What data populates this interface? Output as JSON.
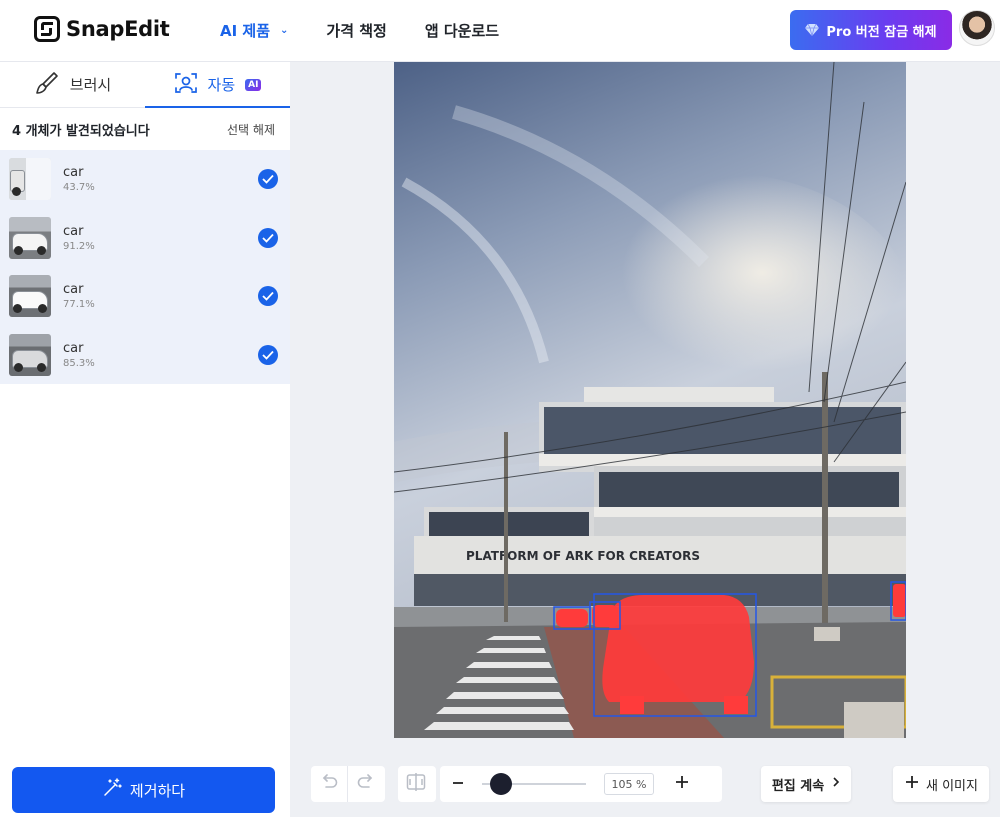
{
  "header": {
    "logo_text": "SnapEdit",
    "nav": [
      {
        "label": "AI 제품",
        "active": true,
        "has_dropdown": true
      },
      {
        "label": "가격 책정",
        "active": false
      },
      {
        "label": "앱 다운로드",
        "active": false
      }
    ],
    "pro_button": "Pro 버전 잠금 해제"
  },
  "sidebar": {
    "tabs": [
      {
        "label": "브러시",
        "icon": "brush-icon",
        "active": false
      },
      {
        "label": "자동",
        "icon": "face-scan-icon",
        "badge": "AI",
        "active": true
      }
    ],
    "found_text": "4 개체가 발견되었습니다",
    "deselect_label": "선택 해제",
    "objects": [
      {
        "label": "car",
        "score": "43.7%",
        "selected": true
      },
      {
        "label": "car",
        "score": "91.2%",
        "selected": true
      },
      {
        "label": "car",
        "score": "77.1%",
        "selected": true
      },
      {
        "label": "car",
        "score": "85.3%",
        "selected": true
      }
    ],
    "remove_button": "제거하다"
  },
  "canvas": {
    "building_sign": "PLATFORM OF ARK FOR CREATORS",
    "mask_color": "#ff3b3b",
    "box_color": "#2457e6"
  },
  "toolbar": {
    "zoom_value": "105 %",
    "zoom_level_fraction": 0.1,
    "continue_label": "편집 계속",
    "new_image_label": "새 이미지"
  },
  "colors": {
    "accent": "#1a63e8",
    "pro_gradient_start": "#3b6cf0",
    "pro_gradient_end": "#8a2be6",
    "selected_list_bg": "#edf1fa"
  }
}
